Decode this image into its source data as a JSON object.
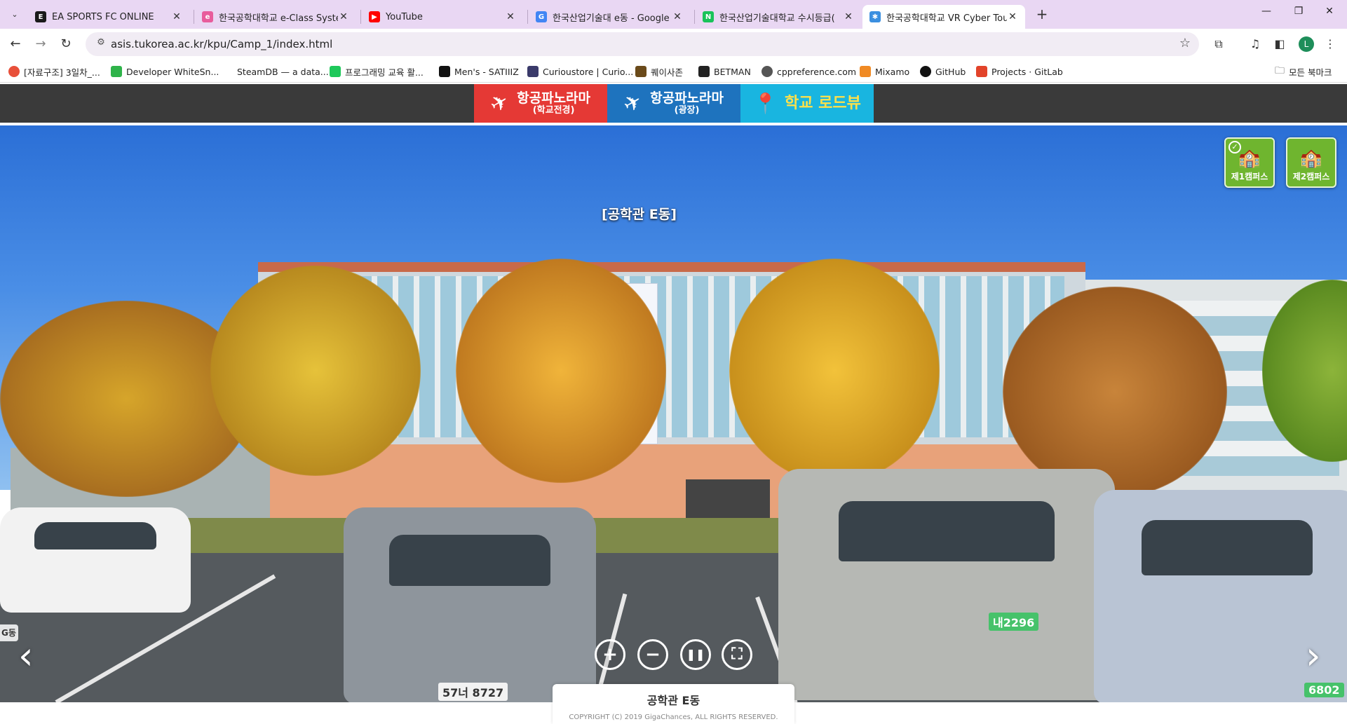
{
  "browser": {
    "tabs": [
      {
        "title": "EA SPORTS FC ONLINE",
        "favicon_color": "#1a1a1a",
        "favicon_glyph": "E"
      },
      {
        "title": "한국공학대학교 e-Class System",
        "favicon_color": "#e85c9c",
        "favicon_glyph": "e"
      },
      {
        "title": "YouTube",
        "favicon_color": "#ff0000",
        "favicon_glyph": "▶"
      },
      {
        "title": "한국산업기술대 e동 - Google",
        "favicon_color": "#4285f4",
        "favicon_glyph": "G"
      },
      {
        "title": "한국산업기술대학교 수시등급(",
        "favicon_color": "#19c35a",
        "favicon_glyph": "N"
      },
      {
        "title": "한국공학대학교 VR Cyber Tour",
        "favicon_color": "#3b8fe0",
        "favicon_glyph": "✱"
      }
    ],
    "active_tab_index": 5,
    "close_glyph": "✕",
    "new_tab_glyph": "+",
    "window_controls": {
      "minimize": "—",
      "restore": "❐",
      "close": "✕"
    },
    "toolbar": {
      "back": "←",
      "forward": "→",
      "reload": "↻",
      "url": "asis.tukorea.ac.kr/kpu/Camp_1/index.html",
      "site_info_icon": "⚙",
      "star_icon": "☆",
      "extensions_icon": "⧉",
      "media_icon": "♫",
      "sidepanel_icon": "◧",
      "profile_initial": "L",
      "menu_icon": "⋮"
    },
    "bookmarks": [
      {
        "label": "[자료구조] 3일차_...",
        "color": "#e8503a"
      },
      {
        "label": "Developer WhiteSn...",
        "color": "#2fb34a"
      },
      {
        "label": "SteamDB — a data...",
        "color": "#ffffff"
      },
      {
        "label": "프로그래밍 교육 활...",
        "color": "#1ec85a"
      },
      {
        "label": "Men's - SATIIIZ",
        "color": "#111111"
      },
      {
        "label": "Curioustore | Curio...",
        "color": "#3a3a6a"
      },
      {
        "label": "퀘이사존",
        "color": "#6a4a1a"
      },
      {
        "label": "BETMAN",
        "color": "#222222"
      },
      {
        "label": "cppreference.com",
        "color": "#555555"
      },
      {
        "label": "Mixamo",
        "color": "#f08a24"
      },
      {
        "label": "GitHub",
        "color": "#111111"
      },
      {
        "label": "Projects · GitLab",
        "color": "#e2432a"
      }
    ],
    "all_bookmarks": "모든 북마크"
  },
  "site": {
    "nav": [
      {
        "main": "항공파노라마",
        "sub": "(학교전경)",
        "color": "#e53935"
      },
      {
        "main": "항공파노라마",
        "sub": "(광장)",
        "color": "#1e73be"
      },
      {
        "main": "학교 로드뷰",
        "sub": "",
        "color": "#19b5e0"
      }
    ],
    "location_label": "[공학관 E동]",
    "campus_buttons": [
      {
        "label": "제1캠퍼스",
        "checked": true
      },
      {
        "label": "제2캠퍼스",
        "checked": false
      }
    ],
    "side_caption": "G동",
    "controls": {
      "zoom_in": "+",
      "zoom_out": "−",
      "pause": "❚❚",
      "fullscreen": "⛶"
    },
    "prev_arrow": "‹",
    "next_arrow": "›",
    "plates": {
      "left": "57너 8727",
      "center": "내2296",
      "right": "6802"
    },
    "footer": {
      "building_name": "공학관 E동",
      "copyright": "COPYRIGHT (C) 2019 GigaChances, ALL RIGHTS RESERVED."
    }
  }
}
